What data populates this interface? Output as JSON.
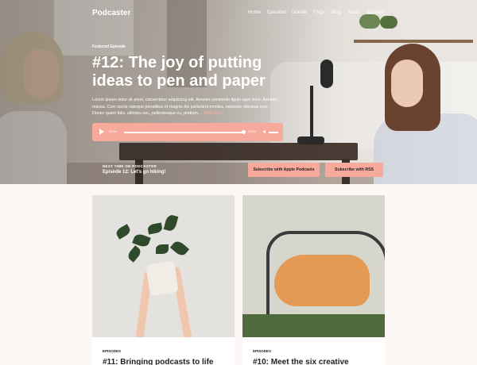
{
  "header": {
    "logo": "Podcaster",
    "nav": [
      "Home",
      "Episodes",
      "Donate",
      "FAQs",
      "Blog",
      "About",
      "Contact"
    ]
  },
  "hero": {
    "kicker": "Featured Episode",
    "title": "#12: The joy of putting ideas to pen and paper",
    "excerpt": "Lorem ipsum dolor sit amet, consectetur adipiscing elit. Aenean commodo ligula eget dolor. Aenean massa. Cum sociis natoque penatibus et magnis dis parturient montes, nascetur ridiculus mus. Donec quam felis, ultricies nec, pellentesque eu, pretium…",
    "read_more": "Read More",
    "player": {
      "current_time": "00:00",
      "duration": "00:00",
      "progress": 0
    },
    "next_label": "NEXT TIME ON PODCASTER",
    "next_title": "Episode 12: Let's go hiking!",
    "subscribe_apple": "Subscribe with Apple Podcasts",
    "subscribe_rss": "Subscribe with RSS"
  },
  "cards": [
    {
      "category": "EPISODES",
      "title": "#11: Bringing podcasts to life"
    },
    {
      "category": "EPISODES",
      "title": "#10: Meet the six creative"
    }
  ],
  "colors": {
    "accent": "#f7aa9b",
    "background": "#fdf8f6"
  }
}
